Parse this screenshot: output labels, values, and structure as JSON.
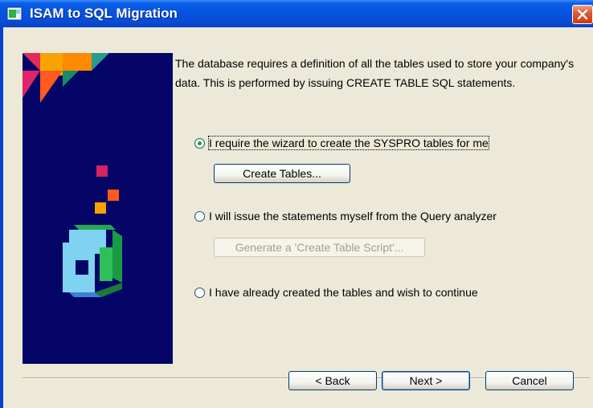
{
  "window": {
    "title": "ISAM to SQL Migration"
  },
  "description": "The database requires a definition of all the tables used to store your company's data.  This is performed by issuing CREATE TABLE SQL statements.",
  "options": [
    {
      "label": "I require the wizard to create the SYSPRO tables for me",
      "checked": true
    },
    {
      "label": "I will issue the statements myself from the Query analyzer",
      "checked": false
    },
    {
      "label": "I have already created the tables and wish to continue",
      "checked": false
    }
  ],
  "buttons": {
    "create_tables": "Create Tables...",
    "generate_script": "Generate a 'Create Table Script'...",
    "back": "< Back",
    "next": "Next >",
    "cancel": "Cancel"
  },
  "colors": {
    "titlebar": "#0554e0",
    "dialog_bg": "#ece9d8",
    "banner_bg": "#050567",
    "radio_dot": "#21a121"
  },
  "icons": [
    "app-icon",
    "close-icon",
    "sql-migration-logo"
  ]
}
